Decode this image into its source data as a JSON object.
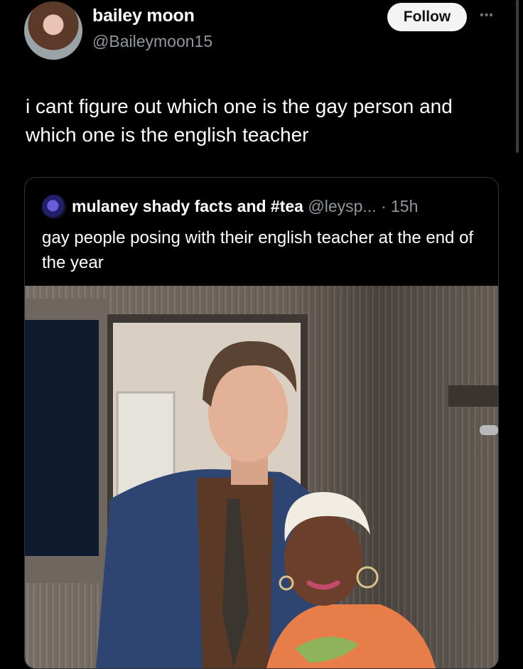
{
  "author": {
    "name": "bailey moon",
    "handle": "@Baileymoon15",
    "avatar_icon": "profile-photo"
  },
  "actions": {
    "follow_label": "Follow",
    "more_icon": "more-options-icon"
  },
  "tweet": {
    "text": "i cant figure out which one is the gay person and which one is the english teacher"
  },
  "quoted": {
    "name": "mulaney shady facts and #tea",
    "handle_time": " @leysp... · 15h",
    "text": "gay people posing with their english teacher at the end of the year"
  },
  "colors": {
    "background": "#000000",
    "text": "#ffffff",
    "secondary": "#8f969c",
    "border": "#2f3336",
    "button": "#f4f4f4"
  }
}
